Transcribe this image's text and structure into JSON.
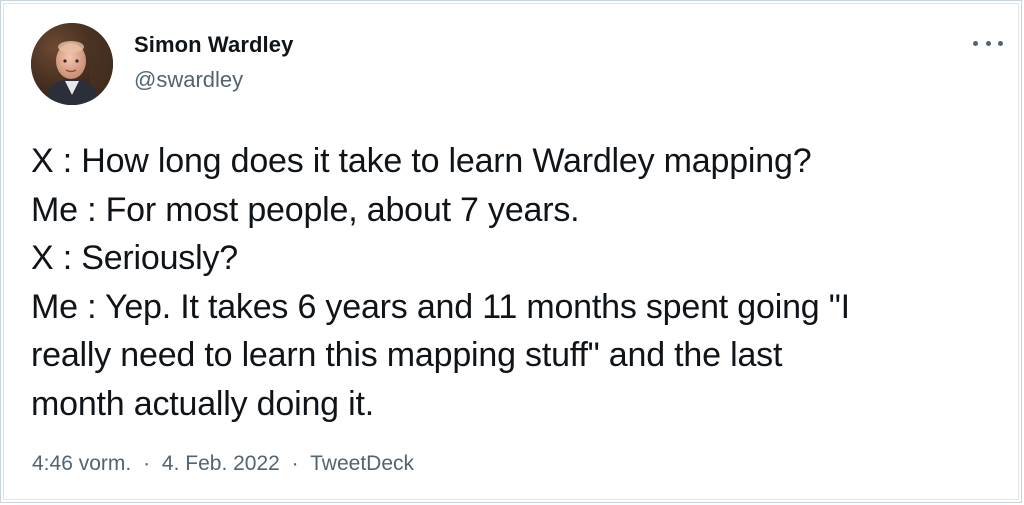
{
  "author": {
    "name": "Simon Wardley",
    "handle": "@swardley"
  },
  "tweet": {
    "lines": [
      "X : How long does it take to learn Wardley mapping?",
      "Me : For most people, about 7 years.",
      "X : Seriously?",
      "Me : Yep. It takes 6 years and 11 months spent going \"I",
      "really need to learn this mapping stuff\" and the last",
      "month actually doing it."
    ]
  },
  "meta": {
    "time": "4:46 vorm.",
    "separator": "·",
    "date": "4. Feb. 2022",
    "source": "TweetDeck"
  },
  "icons": {
    "more": "more-horizontal-icon",
    "avatar": "profile-photo"
  },
  "colors": {
    "text_primary": "#0f1419",
    "text_secondary": "#536471",
    "border": "#c9d3db"
  }
}
